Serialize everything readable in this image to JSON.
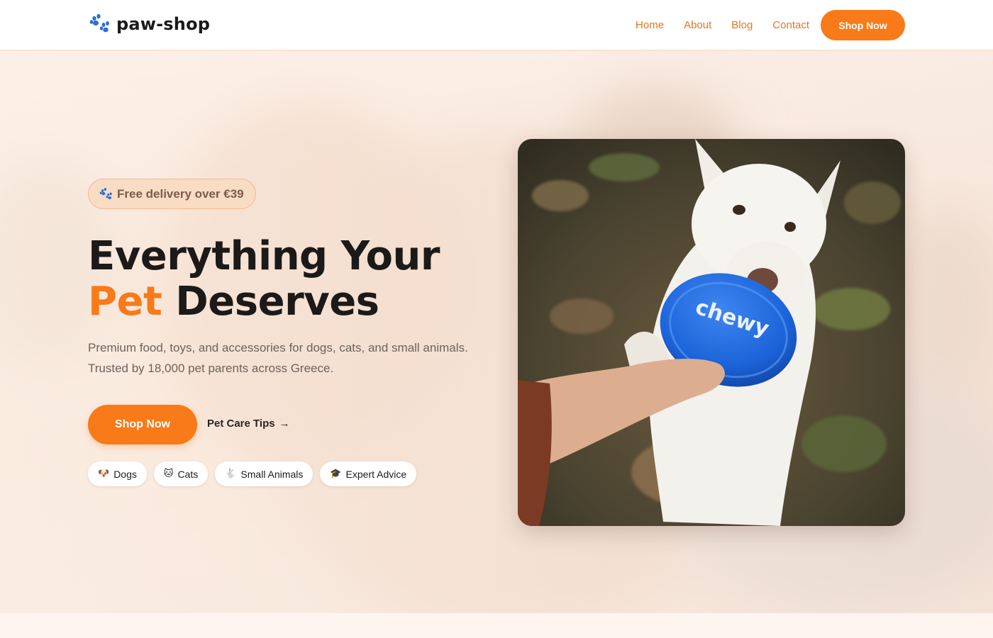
{
  "brand": {
    "name": "paw-shop",
    "logo_icon": "paw-icon",
    "accent": "#f97a18"
  },
  "nav": {
    "links": [
      "Home",
      "About",
      "Blog",
      "Contact"
    ],
    "cta": "Shop Now"
  },
  "hero": {
    "badge": {
      "icon": "paw-icon",
      "text": "Free delivery over €39"
    },
    "headline_line1": "Everything Your",
    "headline_accent": "Pet",
    "headline_rest": "Deserves",
    "subtitle_line1": "Premium food, toys, and accessories for dogs, cats, and small animals.",
    "subtitle_line2": "Trusted by 18,000 pet parents across Greece.",
    "primary_cta": "Shop Now",
    "secondary_cta": "Pet Care Tips",
    "secondary_arrow": "→",
    "chips": [
      {
        "emoji": "🐶",
        "label": "Dogs"
      },
      {
        "emoji": "🐱",
        "label": "Cats"
      },
      {
        "emoji": "🐇",
        "label": "Small Animals"
      },
      {
        "emoji": "🎓",
        "label": "Expert Advice"
      }
    ],
    "image": {
      "frisbee_text": "chewy"
    }
  },
  "colors": {
    "accent": "#f97a18",
    "nav_link": "#e8751a",
    "badge_bg": "#f9dcc4",
    "badge_border": "#f3b98d",
    "frisbee": "#1c63d9"
  }
}
